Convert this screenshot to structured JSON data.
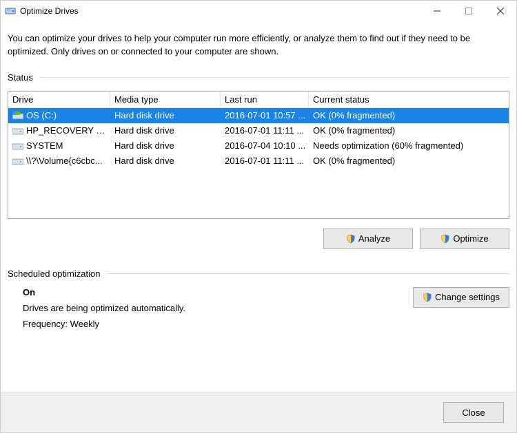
{
  "window": {
    "title": "Optimize Drives"
  },
  "description": "You can optimize your drives to help your computer run more efficiently, or analyze them to find out if they need to be optimized. Only drives on or connected to your computer are shown.",
  "status_label": "Status",
  "columns": {
    "drive": "Drive",
    "media": "Media type",
    "run": "Last run",
    "status": "Current status"
  },
  "rows": [
    {
      "drive": "OS (C:)",
      "icon": "os",
      "media": "Hard disk drive",
      "run": "2016-07-01 10:57 ...",
      "status": "OK (0% fragmented)",
      "selected": true
    },
    {
      "drive": "HP_RECOVERY (D:)",
      "icon": "hdd",
      "media": "Hard disk drive",
      "run": "2016-07-01 11:11 ...",
      "status": "OK (0% fragmented)",
      "selected": false
    },
    {
      "drive": "SYSTEM",
      "icon": "hdd",
      "media": "Hard disk drive",
      "run": "2016-07-04 10:10 ...",
      "status": "Needs optimization (60% fragmented)",
      "selected": false
    },
    {
      "drive": "\\\\?\\Volume{c6cbc...",
      "icon": "hdd",
      "media": "Hard disk drive",
      "run": "2016-07-01 11:11 ...",
      "status": "OK (0% fragmented)",
      "selected": false
    }
  ],
  "buttons": {
    "analyze": "Analyze",
    "optimize": "Optimize",
    "change_settings": "Change settings",
    "close": "Close"
  },
  "scheduled": {
    "label": "Scheduled optimization",
    "on": "On",
    "line1": "Drives are being optimized automatically.",
    "line2": "Frequency: Weekly"
  }
}
